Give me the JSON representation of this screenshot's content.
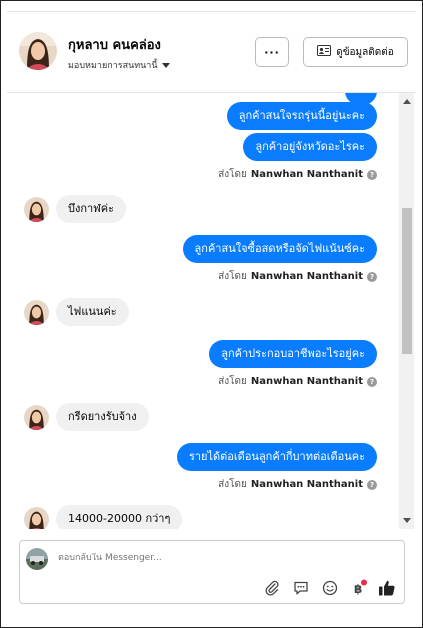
{
  "header": {
    "name": "กุหลาบ คนคล่อง",
    "assign_label": "มอบหมายการสนทนานี้",
    "more_label": "···",
    "contact_button_label": "ดูข้อมูลติดต่อ"
  },
  "messages": [
    {
      "dir": "out",
      "text": "ลูกค้าสนใจรถรุ่นนี้อยู่นะคะ"
    },
    {
      "dir": "out",
      "text": "ลูกค้าอยู่จังหวัดอะไรคะ"
    },
    {
      "dir": "in",
      "text": "บึงกาฬค่ะ"
    },
    {
      "dir": "out",
      "text": "ลูกค้าสนใจซื้อสดหรือจัดไฟแน้นซ์คะ"
    },
    {
      "dir": "in",
      "text": "ไฟแนนค่ะ"
    },
    {
      "dir": "out",
      "text": "ลูกค้าประกอบอาชีพอะไรอยู่คะ"
    },
    {
      "dir": "in",
      "text": "กรีดยางรับจ้าง"
    },
    {
      "dir": "out",
      "text": "รายได้ต่อเดือนลูกค้ากี่บาทต่อเดือนคะ"
    },
    {
      "dir": "in",
      "text": "14000-20000 กว่าๆ"
    }
  ],
  "sent_by": {
    "prefix": "ส่งโดย",
    "name": "Nanwhan Nanthanit",
    "help": "?"
  },
  "composer": {
    "placeholder": "ตอบกลับใน Messenger..."
  },
  "colors": {
    "outgoing": "#0a7cff",
    "incoming": "#f0f0f0",
    "like": "#050505"
  },
  "icons": [
    "attach-icon",
    "saved-reply-icon",
    "emoji-icon",
    "payment-icon",
    "like-icon"
  ]
}
